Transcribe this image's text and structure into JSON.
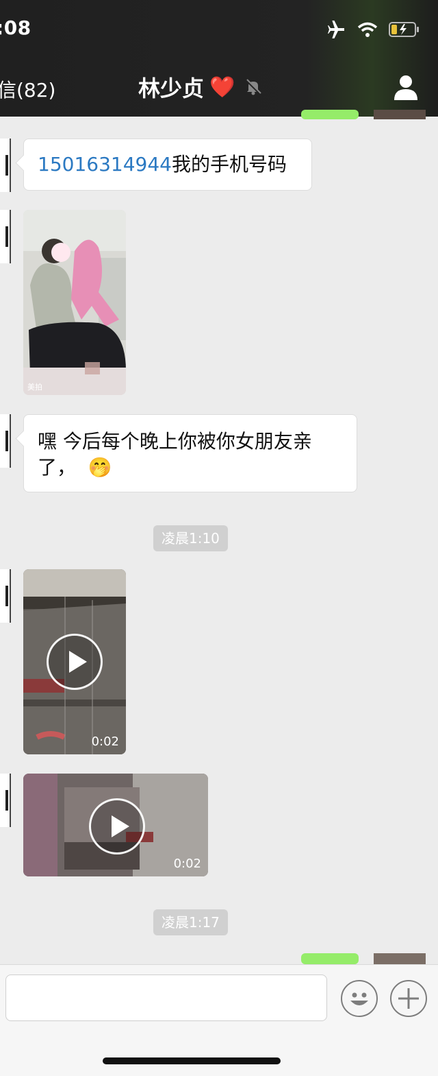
{
  "status_bar": {
    "time": ":08"
  },
  "nav": {
    "back_label": "信(82)",
    "title": "林少贞",
    "title_heart": "❤️"
  },
  "messages": {
    "m1_phone": "15016314944",
    "m1_text": "我的手机号码",
    "m3_line1": "嘿 今后每个晚上你被你女朋友亲",
    "m3_line2": "了，",
    "m3_emoji": "🤭",
    "photo_watermark": "美拍"
  },
  "timestamps": {
    "t1": "凌晨1:10",
    "t2": "凌晨1:17"
  },
  "videos": [
    {
      "duration": "0:02"
    },
    {
      "duration": "0:02"
    }
  ],
  "input": {
    "placeholder": ""
  },
  "colors": {
    "link": "#2b79c2",
    "sent_bubble": "#95ec69",
    "chat_bg": "#ececec"
  }
}
